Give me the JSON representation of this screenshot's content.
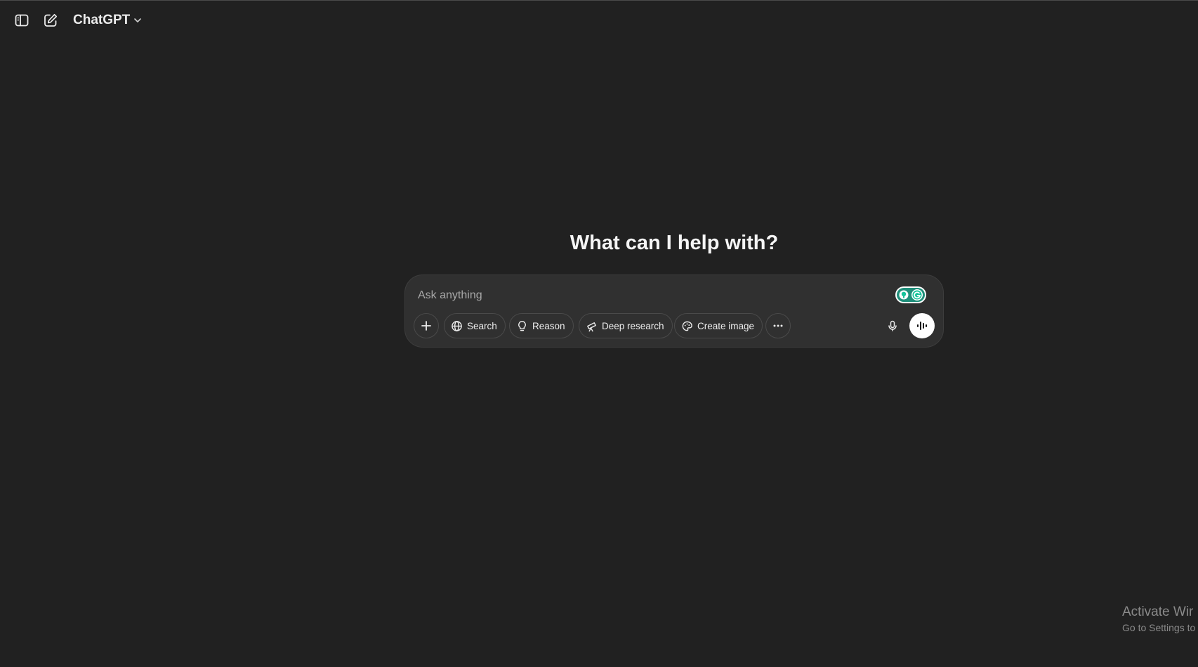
{
  "header": {
    "model_name": "ChatGPT",
    "icons": [
      "sidebar-toggle-icon",
      "new-chat-icon",
      "chevron-down-icon"
    ]
  },
  "main": {
    "headline": "What can I help with?"
  },
  "composer": {
    "placeholder": "Ask anything",
    "tools": [
      {
        "label": "Search",
        "icon": "globe-icon"
      },
      {
        "label": "Reason",
        "icon": "lightbulb-icon"
      },
      {
        "label": "Deep research",
        "icon": "telescope-icon"
      },
      {
        "label": "Create image",
        "icon": "palette-icon"
      }
    ],
    "icons": [
      "plus-icon",
      "more-icon",
      "microphone-icon",
      "voice-mode-icon"
    ]
  },
  "os_watermark": {
    "line1": "Activate Wir",
    "line2": "Go to Settings to"
  },
  "colors": {
    "background": "#212121",
    "composer": "#303030",
    "grammarly_green": "#15c39a"
  }
}
